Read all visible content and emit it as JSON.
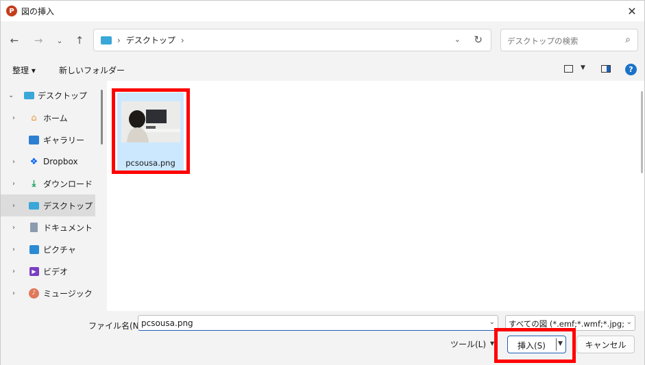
{
  "window": {
    "title": "図の挿入",
    "app_icon": "P",
    "accent": "#c43e1c"
  },
  "address": {
    "location": "デスクトップ",
    "separator": "›"
  },
  "search": {
    "placeholder": "デスクトップの検索"
  },
  "toolbar": {
    "organize": "整理 ▾",
    "new_folder": "新しいフォルダー",
    "help": "?"
  },
  "sidebar": {
    "items": [
      {
        "label": "デスクトップ",
        "icon": "desktop-icon"
      },
      {
        "label": "ホーム",
        "icon": "home-icon"
      },
      {
        "label": "ギャラリー",
        "icon": "gallery-icon"
      },
      {
        "label": "Dropbox",
        "icon": "dropbox-icon"
      },
      {
        "label": "ダウンロード",
        "icon": "download-icon"
      },
      {
        "label": "デスクトップ",
        "icon": "desktop-icon",
        "selected": true
      },
      {
        "label": "ドキュメント",
        "icon": "documents-icon"
      },
      {
        "label": "ピクチャ",
        "icon": "pictures-icon"
      },
      {
        "label": "ビデオ",
        "icon": "videos-icon"
      },
      {
        "label": "ミュージック",
        "icon": "music-icon"
      }
    ]
  },
  "files": [
    {
      "name": "pcsousa.png",
      "selected": true
    }
  ],
  "footer": {
    "filename_label": "ファイル名(N):",
    "filename_value": "pcsousa.png",
    "filetype_value": "すべての図 (*.emf;*.wmf;*.jpg;*.jp",
    "tools_label": "ツール(L)",
    "insert_label": "挿入(S)",
    "cancel_label": "キャンセル"
  },
  "colors": {
    "highlight": "#ff0000",
    "selection": "#cce8ff",
    "primary": "#1f5fb4"
  }
}
